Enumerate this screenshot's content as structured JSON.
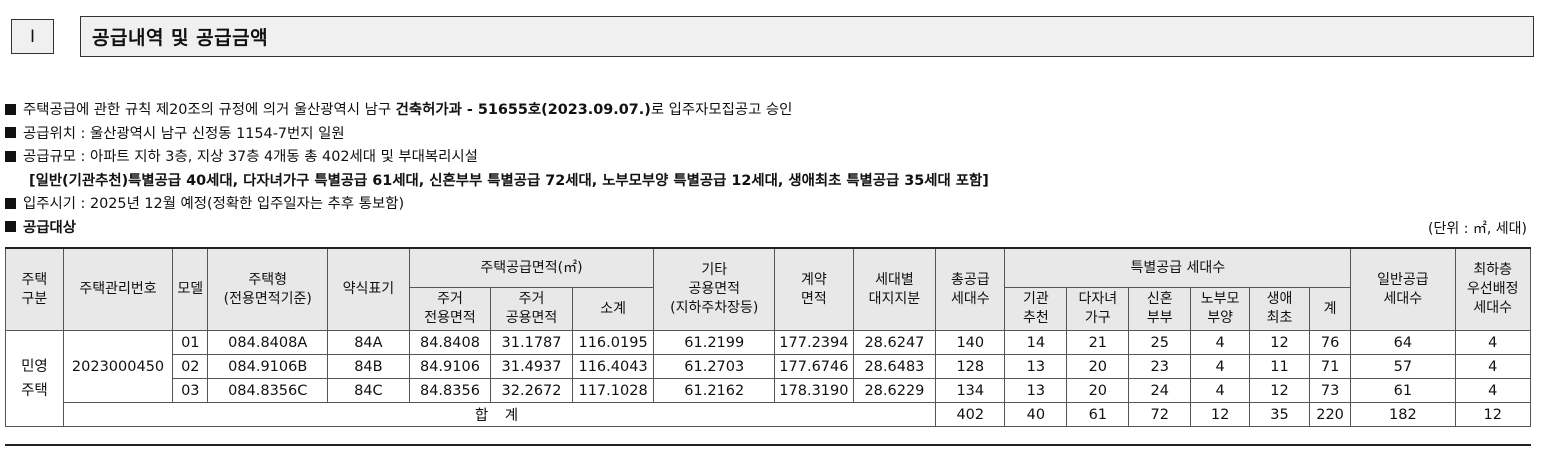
{
  "section": {
    "number": "Ⅰ",
    "title": "공급내역 및 공급금액"
  },
  "info": {
    "line1_pre": "주택공급에 관한 규칙 제20조의 규정에 의거 울산광역시 남구 ",
    "line1_bold": "건축허가과 - 51655호(2023.09.07.)",
    "line1_post": "로 입주자모집공고 승인",
    "line2": "공급위치 : 울산광역시 남구 신정동 1154-7번지 일원",
    "line3": "공급규모 : 아파트 지하 3층, 지상 37층 4개동 총 402세대 및 부대복리시설",
    "line4": "[일반(기관추천)특별공급 40세대, 다자녀가구 특별공급 61세대, 신혼부부 특별공급 72세대, 노부모부양 특별공급 12세대, 생애최초 특별공급 35세대 포함]",
    "line5": "입주시기 : 2025년 12월 예정(정확한 입주일자는 추후 통보함)",
    "target": "공급대상"
  },
  "unit_note": "(단위 : ㎡, 세대)",
  "table": {
    "headers": {
      "type": "주택\n구분",
      "mgmt_no": "주택관리번호",
      "model": "모델",
      "house_type": "주택형\n(전용면적기준)",
      "abbr": "약식표기",
      "supply_area": "주택공급면적(㎡)",
      "exclusive": "주거\n전용면적",
      "common": "주거\n공용면적",
      "subtotal": "소계",
      "other_area": "기타\n공용면적\n(지하주차장등)",
      "contract_area": "계약\n면적",
      "land_share": "세대별\n대지지분",
      "total_supply": "총공급\n세대수",
      "special": "특별공급 세대수",
      "institution": "기관\n추천",
      "multichild": "다자녀\n가구",
      "newlywed": "신혼\n부부",
      "elderly": "노부모\n부양",
      "firsttime": "생애\n최초",
      "special_total": "계",
      "general": "일반공급\n세대수",
      "priority": "최하층\n우선배정\n세대수"
    },
    "type_label": "민영\n주택",
    "mgmt_no": "2023000450",
    "rows": [
      {
        "model": "01",
        "house_type": "084.8408A",
        "abbr": "84A",
        "exclusive": "84.8408",
        "common": "31.1787",
        "subtotal": "116.0195",
        "other": "61.2199",
        "contract": "177.2394",
        "land": "28.6247",
        "total": "140",
        "inst": "14",
        "multi": "21",
        "newly": "25",
        "elder": "4",
        "first": "12",
        "sp_total": "76",
        "general": "64",
        "priority": "4"
      },
      {
        "model": "02",
        "house_type": "084.9106B",
        "abbr": "84B",
        "exclusive": "84.9106",
        "common": "31.4937",
        "subtotal": "116.4043",
        "other": "61.2703",
        "contract": "177.6746",
        "land": "28.6483",
        "total": "128",
        "inst": "13",
        "multi": "20",
        "newly": "23",
        "elder": "4",
        "first": "11",
        "sp_total": "71",
        "general": "57",
        "priority": "4"
      },
      {
        "model": "03",
        "house_type": "084.8356C",
        "abbr": "84C",
        "exclusive": "84.8356",
        "common": "32.2672",
        "subtotal": "117.1028",
        "other": "61.2162",
        "contract": "178.3190",
        "land": "28.6229",
        "total": "134",
        "inst": "13",
        "multi": "20",
        "newly": "24",
        "elder": "4",
        "first": "12",
        "sp_total": "73",
        "general": "61",
        "priority": "4"
      }
    ],
    "sum": {
      "label": "합 계",
      "total": "402",
      "inst": "40",
      "multi": "61",
      "newly": "72",
      "elder": "12",
      "first": "35",
      "sp_total": "220",
      "general": "182",
      "priority": "12"
    }
  }
}
